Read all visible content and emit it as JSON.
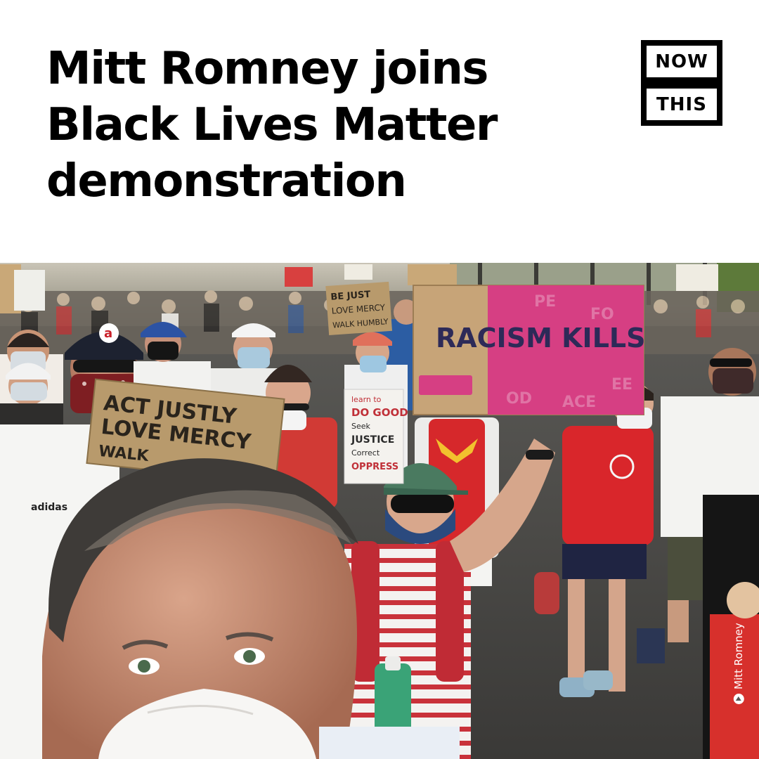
{
  "headline": {
    "line1": "Mitt Romney joins",
    "line2": "Black Lives Matter",
    "line3": "demonstration"
  },
  "logo": {
    "top": "NOW",
    "bottom": "THIS"
  },
  "photo": {
    "credit": "Mitt Romney",
    "signs": {
      "racism": "RACISM KILLS",
      "act_line1": "ACT JUSTLY",
      "act_line2": "LOVE MERCY",
      "act_line3": "WALK",
      "be_line1": "BE JUST",
      "be_line2": "LOVE MERCY",
      "be_line3": "WALK HUMBLY",
      "learn_line1": "learn to",
      "learn_line2": "DO GOOD",
      "learn_line3": "Seek",
      "learn_line4": "JUSTICE",
      "learn_line5": "Correct",
      "learn_line6": "OPPRESS"
    }
  }
}
